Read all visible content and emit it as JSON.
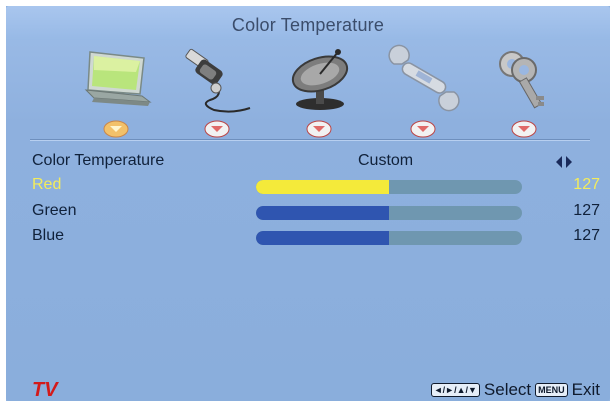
{
  "title": "Color Temperature",
  "menu_icons": [
    "picture-icon",
    "audio-plug-icon",
    "satellite-dish-icon",
    "wrench-icon",
    "keys-icon"
  ],
  "active_menu_index": 0,
  "setting": {
    "label": "Color Temperature",
    "value": "Custom"
  },
  "sliders": [
    {
      "label": "Red",
      "value": "127",
      "level": 0.5,
      "highlighted": true,
      "color": "#f4ea3a"
    },
    {
      "label": "Green",
      "value": "127",
      "level": 0.5,
      "highlighted": false,
      "color": "#2f55b0"
    },
    {
      "label": "Blue",
      "value": "127",
      "level": 0.5,
      "highlighted": false,
      "color": "#2f55b0"
    }
  ],
  "footer": {
    "brand": "TV",
    "nav_key": "◄/►/▲/▼",
    "select_label": "Select",
    "menu_key": "MENU",
    "exit_label": "Exit"
  },
  "colors": {
    "highlight_text": "#f3ec5c",
    "brand": "#d31a1a",
    "active_marker": "#f2c16a",
    "inactive_marker": "#e06a68"
  }
}
